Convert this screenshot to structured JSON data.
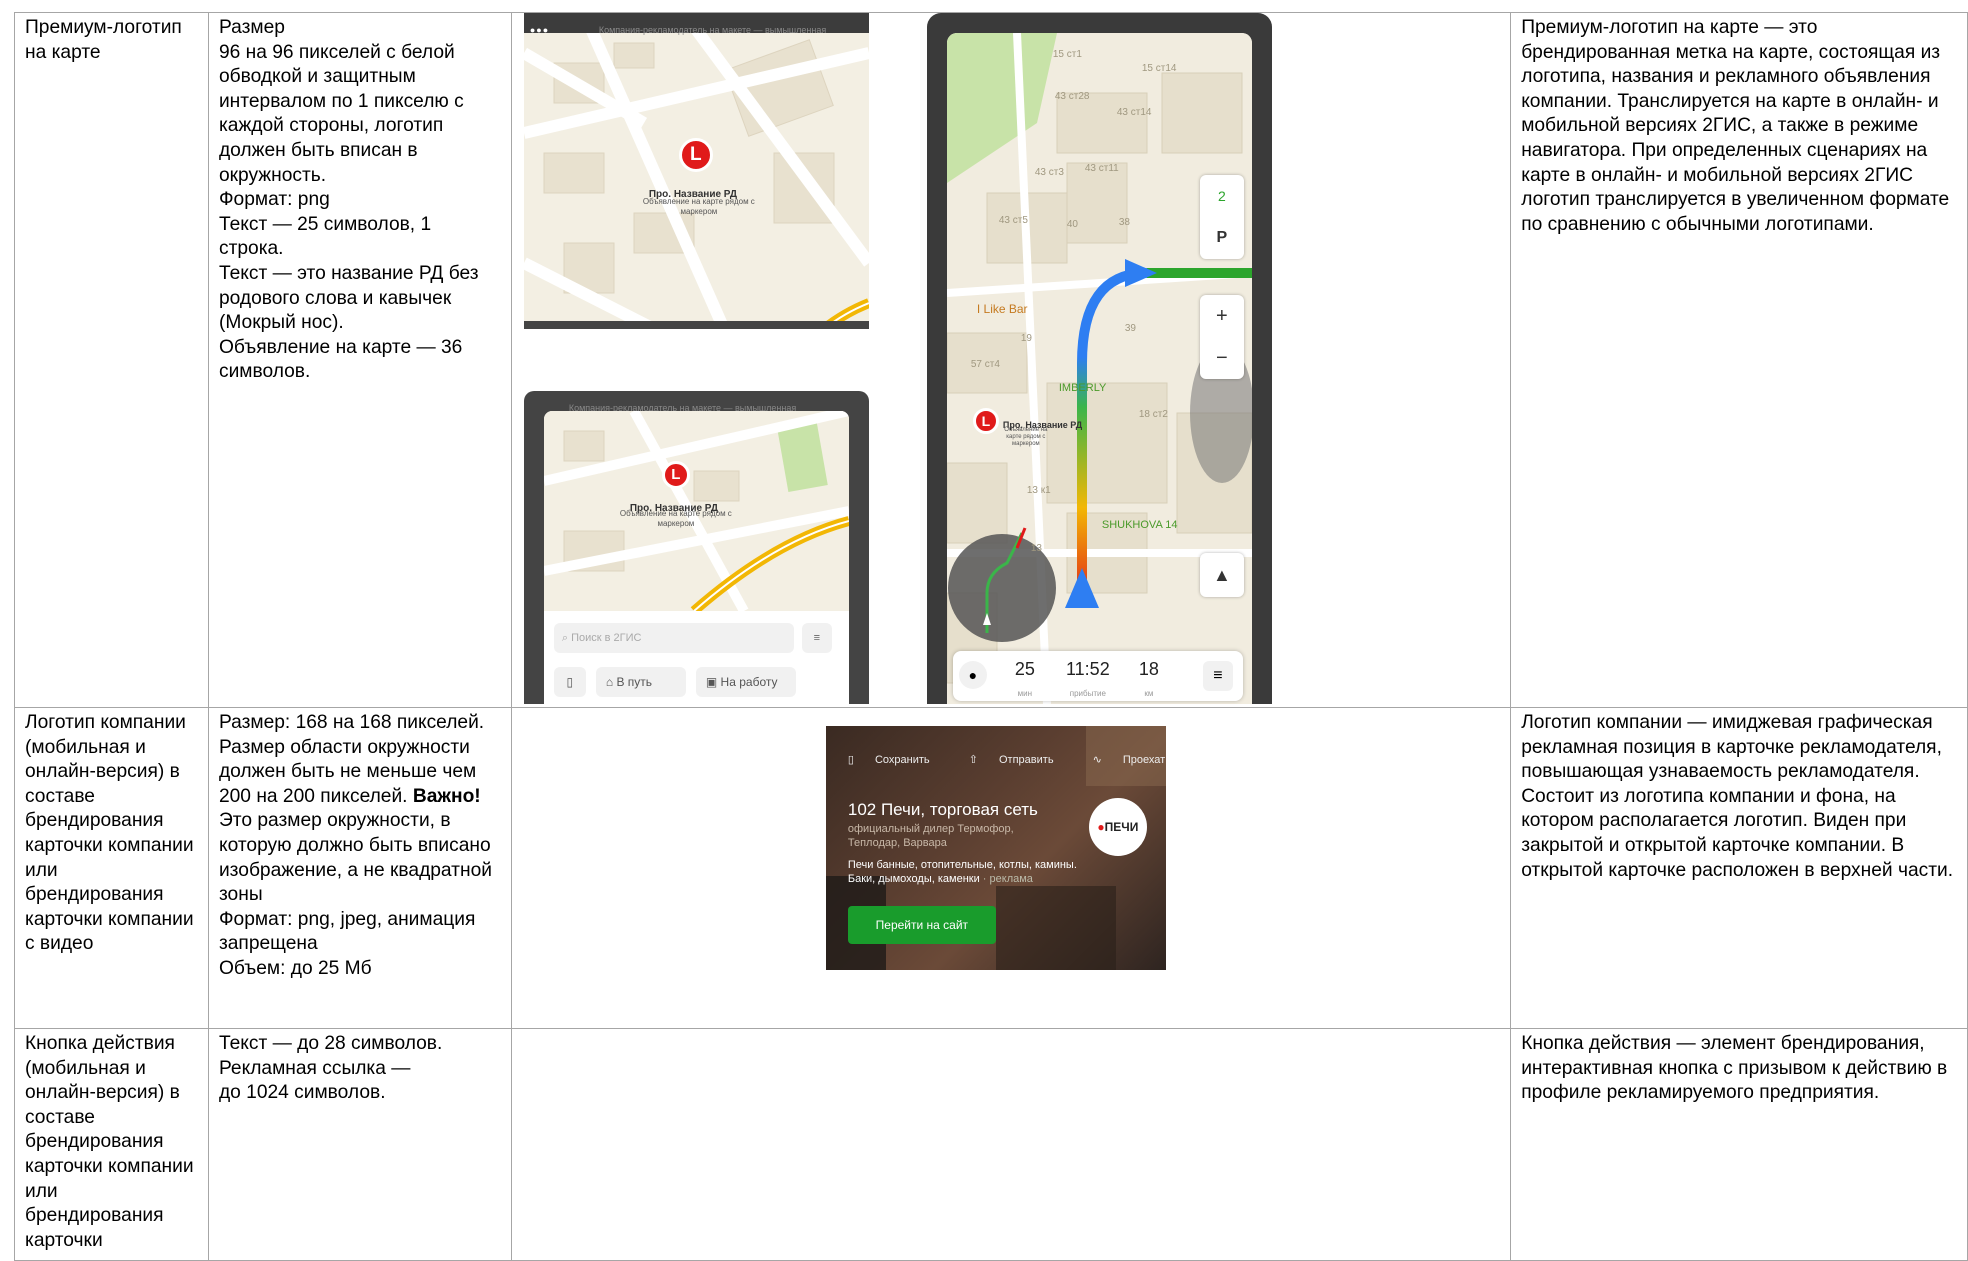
{
  "rows": [
    {
      "name": "Премиум-логотип на карте",
      "spec_lines": [
        "Размер",
        "96 на 96 пикселей с белой обводкой и защитным интервалом по 1 пикселю с каждой стороны, логотип должен быть вписан в окружность.",
        "Формат: png",
        "Текст — 25 символов, 1 строка.",
        "Текст — это название РД без родового слова и кавычек (Мокрый нос).",
        "Объявление на карте — 36 символов."
      ],
      "description": "Премиум-логотип на карте — это брендированная метка на карте, состоящая из логотипа, названия и рекламного объявления компании. Транслируется на карте в онлайн- и мобильной версиях 2ГИС, а также в режиме навигатора. При определенных сценариях на карте в онлайн- и мобильной версиях 2ГИС логотип транслируется в увеличенном формате по сравнению с обычными логотипами."
    },
    {
      "name": "Логотип компании (мобильная и онлайн-версия) в составе брендирования карточки компании или брендирования карточки компании с видео",
      "spec": {
        "line1": "Размер: 168 на 168 пикселей. Размер области окружности должен быть не меньше чем 200 на 200 пикселей. ",
        "important": "Важно!",
        "line1_tail": " Это размер окружности, в которую должно быть вписано изображение, а не квадратной зоны",
        "format": "Формат: png, jpeg, анимация запрещена",
        "volume": "Объем: до 25 Мб"
      },
      "description": "Логотип компании — имиджевая графическая рекламная позиция в карточке рекламодателя, повышающая узнаваемость рекламодателя. Состоит из логотипа компании и фона, на котором располагается логотип. Виден при закрытой и открытой карточке компании. В открытой карточке расположен в верхней части."
    },
    {
      "name": "Кнопка действия (мобильная и онлайн-версия) в составе брендирования карточки компании или брендирования карточки",
      "spec_lines": [
        "Текст — до 28 символов.",
        "Рекламная ссылка —",
        "до 1024 символов."
      ],
      "description": "Кнопка действия — элемент брендирования, интерактивная кнопка с призывом к действию в профиле рекламируемого предприятия."
    }
  ],
  "mock_desktop": {
    "window_title": "Компания-рекламодатель на макете — вымышленная",
    "marker_letter": "L",
    "title": "Про. Название РД",
    "subtitle": "Объявление на карте рядом с маркером"
  },
  "mock_phone": {
    "window_title": "Компания-рекламодатель на макете — вымышленная",
    "marker_letter": "L",
    "title": "Про. Название РД",
    "subtitle": "Объявление на карте рядом с маркером",
    "search_placeholder": "Поиск в 2ГИС",
    "btn_route": "В путь",
    "btn_work": "На работу"
  },
  "mock_nav": {
    "labels": [
      "15 ст1",
      "15 ст14",
      "43 ст28",
      "43 ст14",
      "43 ст3",
      "43 ст11",
      "43 ст5",
      "40",
      "38",
      "39",
      "19",
      "57 ст4",
      "18 ст2",
      "13 к1",
      "13",
      "I Like Bar",
      "IMBERLY",
      "SHUKHOVA 14"
    ],
    "marker_letter": "L",
    "title": "Про. Название РД",
    "subtitle": "Объявление на карте рядом с маркером",
    "ctl_badge": "2",
    "ctl_parking": "P",
    "ctl_plus": "+",
    "ctl_minus": "−",
    "time_min": "25",
    "time_min_label": "мин",
    "arrival": "11:52",
    "arrival_label": "прибытие",
    "dist": "18",
    "dist_label": "км",
    "menu_icon": "hamburger"
  },
  "card": {
    "save": "Сохранить",
    "send": "Отправить",
    "route": "Проехать",
    "company": "102 Печи, торговая сеть",
    "subtitle": "официальный дилер Термофор, Теплодар, Варвара",
    "desc_line1": "Печи банные, отопительные, котлы, камины.",
    "desc_line2": "Баки, дымоходы, каменки",
    "ad_tag": "· реклама",
    "button": "Перейти на сайт",
    "logo_text": "ПЕЧИ"
  },
  "colors": {
    "brand_green": "#199c2c",
    "marker_red": "#e01a1a"
  }
}
